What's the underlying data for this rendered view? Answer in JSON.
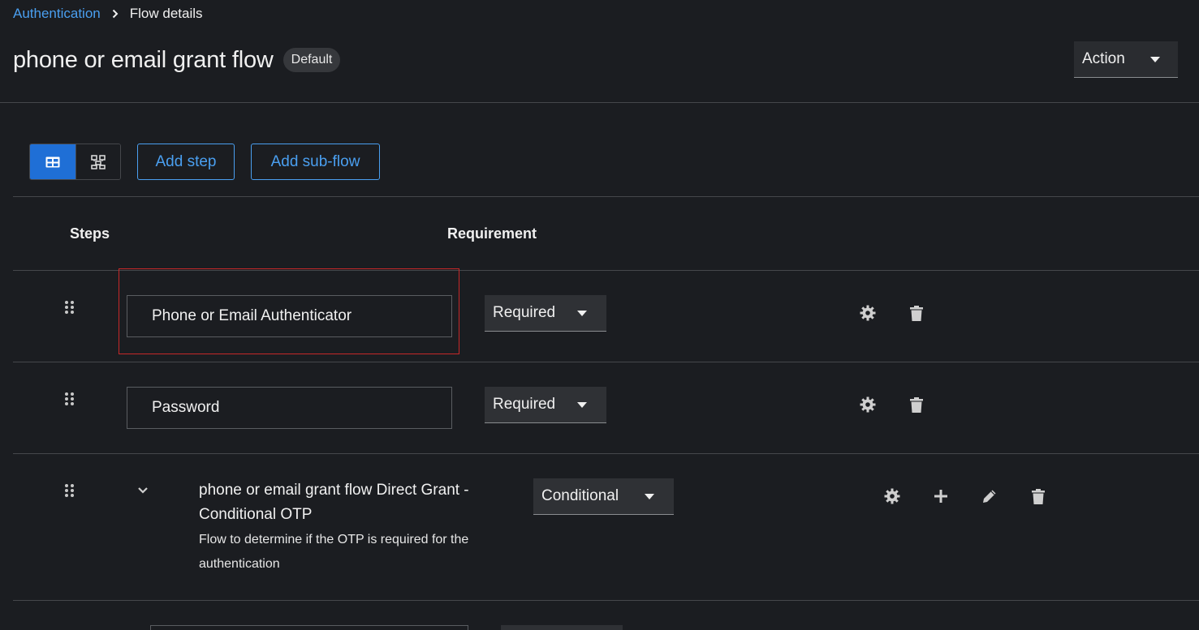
{
  "breadcrumb": {
    "parent": "Authentication",
    "current": "Flow details"
  },
  "header": {
    "title": "phone or email grant flow",
    "badge": "Default",
    "action_label": "Action"
  },
  "toolbar": {
    "view_table_icon": "table-view-icon",
    "view_diagram_icon": "diagram-view-icon",
    "add_step": "Add step",
    "add_subflow": "Add sub-flow"
  },
  "table": {
    "columns": [
      "Steps",
      "Requirement"
    ],
    "rows": [
      {
        "name": "Phone or Email Authenticator",
        "requirement": "Required",
        "highlighted": true,
        "actions": [
          "gear-icon",
          "trash-icon"
        ]
      },
      {
        "name": "Password",
        "requirement": "Required",
        "highlighted": false,
        "actions": [
          "gear-icon",
          "trash-icon"
        ]
      },
      {
        "name": "phone or email grant flow Direct Grant - Conditional OTP",
        "description": "Flow to determine if the OTP is required for the authentication",
        "requirement": "Conditional",
        "expandable": true,
        "actions": [
          "gear-icon",
          "plus-icon",
          "pencil-icon",
          "trash-icon"
        ]
      }
    ]
  },
  "colors": {
    "background": "#1b1d21",
    "link": "#4a9ff0",
    "primary": "#1f6fd6",
    "highlight_border": "#c62828",
    "border": "#45474b"
  }
}
